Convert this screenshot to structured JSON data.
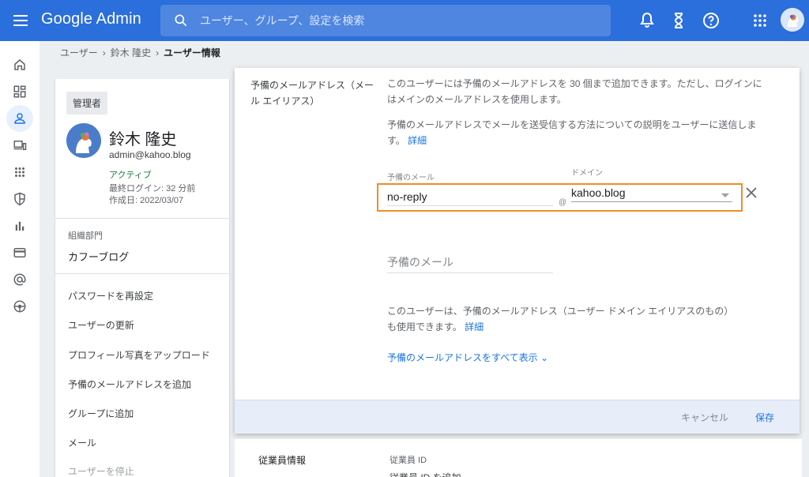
{
  "header": {
    "app_title": "Google Admin",
    "search_placeholder": "ユーザー、グループ、設定を検索",
    "icons": [
      "menu-icon",
      "search-icon",
      "bell-icon",
      "hourglass-icon",
      "help-icon",
      "apps-grid-icon",
      "account-avatar"
    ]
  },
  "rail": {
    "items": [
      "home-icon",
      "dashboard-icon",
      "users-icon",
      "devices-icon",
      "apps-icon",
      "security-icon",
      "reports-icon",
      "billing-icon",
      "account-icon",
      "rules-icon"
    ]
  },
  "breadcrumb": [
    "ユーザー",
    "鈴木 隆史",
    "ユーザー情報"
  ],
  "user": {
    "role": "管理者",
    "name": "鈴木 隆史",
    "email": "admin@kahoo.blog",
    "status": "アクティブ",
    "last_login": "最終ログイン: 32 分前",
    "created": "作成日: 2022/03/07",
    "org_label": "組織部門",
    "org_value": "カフーブログ"
  },
  "actions": [
    "パスワードを再設定",
    "ユーザーの更新",
    "プロフィール写真をアップロード",
    "予備のメールアドレスを追加",
    "グループに追加",
    "メール",
    "ユーザーを停止"
  ],
  "alias_panel": {
    "label": "予備のメールアドレス（メール エイリアス）",
    "desc1": "このユーザーには予備のメールアドレスを 30 個まで追加できます。ただし、ログインにはメインのメールアドレスを使用します。",
    "desc2": "予備のメールアドレスでメールを送受信する方法についての説明をユーザーに送信します。",
    "desc2_link": "詳細",
    "alias_field_label": "予備のメール",
    "alias_value": "no-reply",
    "at": "@",
    "domain_label": "ドメイン",
    "domain_value": "kahoo.blog",
    "new_alias_placeholder": "予備のメール",
    "note": "このユーザーは、予備のメールアドレス（ユーザー ドメイン エイリアスのもの）も使用できます。",
    "note_link": "詳細",
    "show_all": "予備のメールアドレスをすべて表示",
    "cancel": "キャンセル",
    "save": "保存"
  },
  "employee": {
    "label": "従業員情報",
    "field": "従業員 ID",
    "add": "従業員 ID を追加"
  },
  "colors": {
    "topbar": "#2a6fdb",
    "highlight": "#f28c28",
    "link": "#1a73e8"
  }
}
